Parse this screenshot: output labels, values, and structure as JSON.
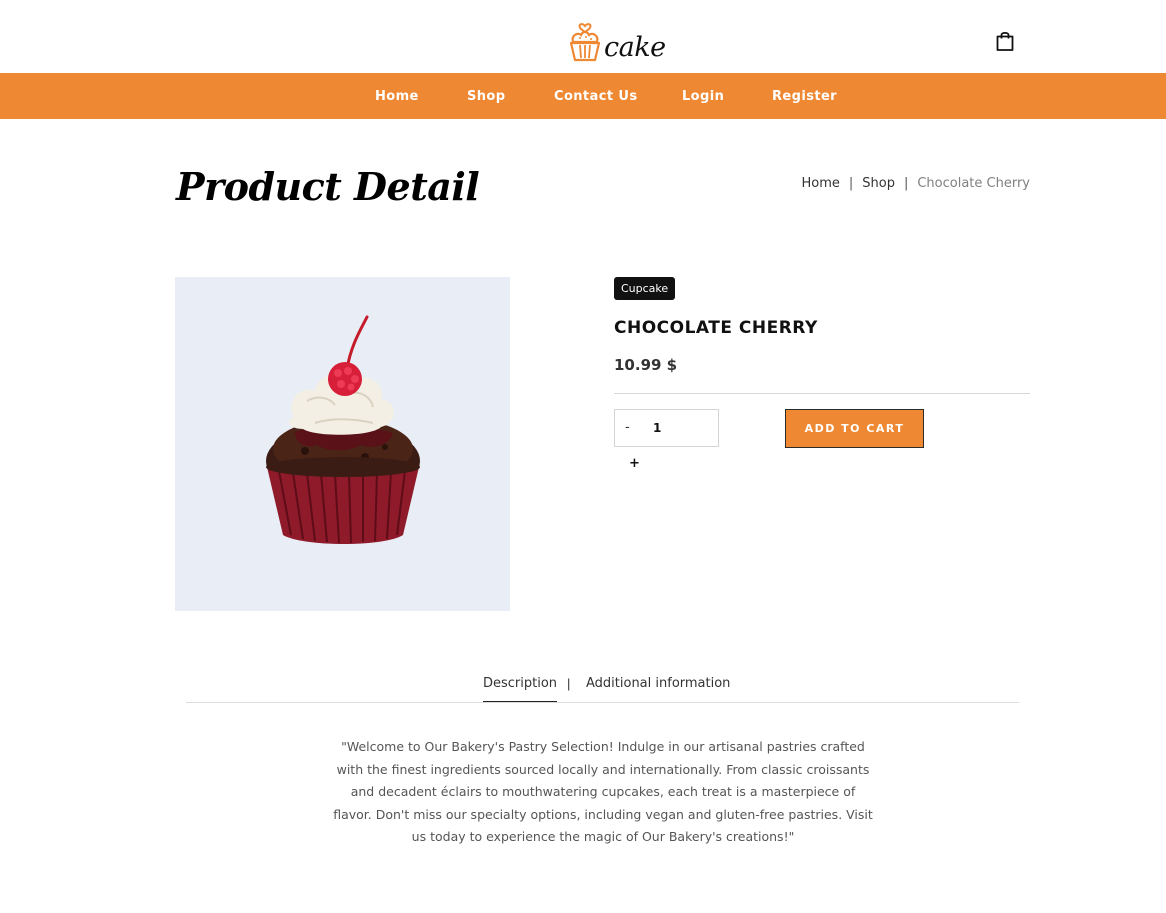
{
  "header": {
    "logo_text": "cake"
  },
  "nav": {
    "items": [
      "Home",
      "Shop",
      "Contact Us",
      "Login",
      "Register"
    ]
  },
  "page": {
    "title": "Product Detail",
    "breadcrumb": [
      "Home",
      "Shop",
      "Chocolate Cherry"
    ]
  },
  "product": {
    "category": "Cupcake",
    "name": "CHOCOLATE CHERRY",
    "price": "10.99 $",
    "quantity": "1",
    "minus_label": "-",
    "plus_label": "+",
    "add_to_cart_label": "ADD TO CART"
  },
  "tabs": {
    "items": [
      "Description",
      "Additional information"
    ],
    "separator": "|",
    "active": "Description"
  },
  "description": "\"Welcome to Our Bakery's Pastry Selection! Indulge in our artisanal pastries crafted with the finest ingredients sourced locally and internationally. From classic croissants and decadent éclairs to mouthwatering cupcakes, each treat is a masterpiece of flavor. Don't miss our specialty options, including vegan and gluten-free pastries. Visit us today to experience the magic of Our Bakery's creations!\"",
  "colors": {
    "accent": "#ef8833",
    "image_background": "#e9eef6",
    "tag_background": "#111111"
  },
  "icons": {
    "logo": "cupcake-icon",
    "cart": "shopping-bag-icon"
  }
}
